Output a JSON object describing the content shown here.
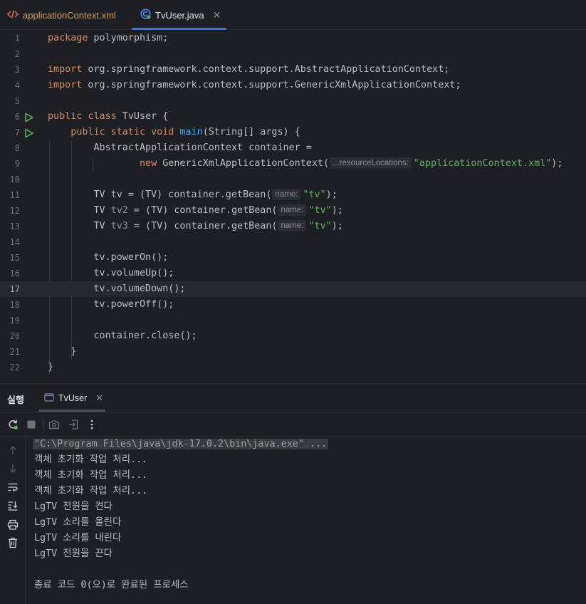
{
  "tabs": [
    {
      "label": "applicationContext.xml",
      "icon": "xml-file-icon",
      "active": false
    },
    {
      "label": "TvUser.java",
      "icon": "java-class-icon",
      "active": true
    }
  ],
  "editor": {
    "line_numbers": [
      "1",
      "2",
      "3",
      "4",
      "5",
      "6",
      "7",
      "8",
      "9",
      "10",
      "11",
      "12",
      "13",
      "14",
      "15",
      "16",
      "17",
      "18",
      "19",
      "20",
      "21",
      "22"
    ],
    "current_line": "17",
    "code": {
      "l1_kw": "package",
      "l1_rest": " polymorphism;",
      "l3_kw": "import",
      "l3_rest": " org.springframework.context.support.AbstractApplicationContext;",
      "l4_kw": "import",
      "l4_rest": " org.springframework.context.support.GenericXmlApplicationContext;",
      "l6_kw": "public class",
      "l6_rest": " TvUser {",
      "l7_kw": "public static void",
      "l7_fn": "main",
      "l7_rest": "(String[] args) {",
      "l8": "AbstractApplicationContext container =",
      "l9_kw": "new",
      "l9_rest": " GenericXmlApplicationContext(",
      "l9_hint": "...resourceLocations:",
      "l9_str": "\"applicationContext.xml\"",
      "l9_end": ");",
      "l11_pre": "TV ",
      "l11_var": "tv",
      "l11_mid": " = (TV) container.getBean(",
      "l11_hint": "name:",
      "l11_str": "\"tv\"",
      "l11_end": ");",
      "l12_pre": "TV ",
      "l12_var": "tv2",
      "l12_mid": " = (TV) container.getBean(",
      "l12_hint": "name:",
      "l12_str": "\"tv\"",
      "l12_end": ");",
      "l13_pre": "TV ",
      "l13_var": "tv3",
      "l13_mid": " = (TV) container.getBean(",
      "l13_hint": "name:",
      "l13_str": "\"tv\"",
      "l13_end": ");",
      "l15": "tv.powerOn();",
      "l16": "tv.volumeUp();",
      "l17": "tv.volumeDown();",
      "l18": "tv.powerOff();",
      "l20": "container.close();",
      "l21": "}",
      "l22": "}"
    }
  },
  "run_panel": {
    "title": "실행",
    "tab_label": "TvUser",
    "toolbar_icons": [
      "rerun-icon",
      "stop-icon",
      "screenshot-icon",
      "exit-icon",
      "more-icon"
    ],
    "side_icons": [
      "up-arrow-icon",
      "down-arrow-icon",
      "soft-wrap-icon",
      "scroll-to-end-icon",
      "print-icon",
      "trash-icon"
    ],
    "console_lines": [
      "\"C:\\Program Files\\java\\jdk-17.0.2\\bin\\java.exe\" ...",
      "객체 초기화 작업 처리...",
      "객체 초기화 작업 처리...",
      "객체 초기화 작업 처리...",
      "LgTV 전원을 켠다",
      "LgTV 소리를 올린다",
      "LgTV 소리를 내린다",
      "LgTV 전원을 끈다",
      "",
      "종료 코드 0(으)로 완료된 프로세스"
    ]
  },
  "colors": {
    "keyword": "#cf8e6d",
    "string": "#6aab73",
    "function": "#56a8f5",
    "accent": "#3574f0",
    "run_green": "#5fb865"
  }
}
